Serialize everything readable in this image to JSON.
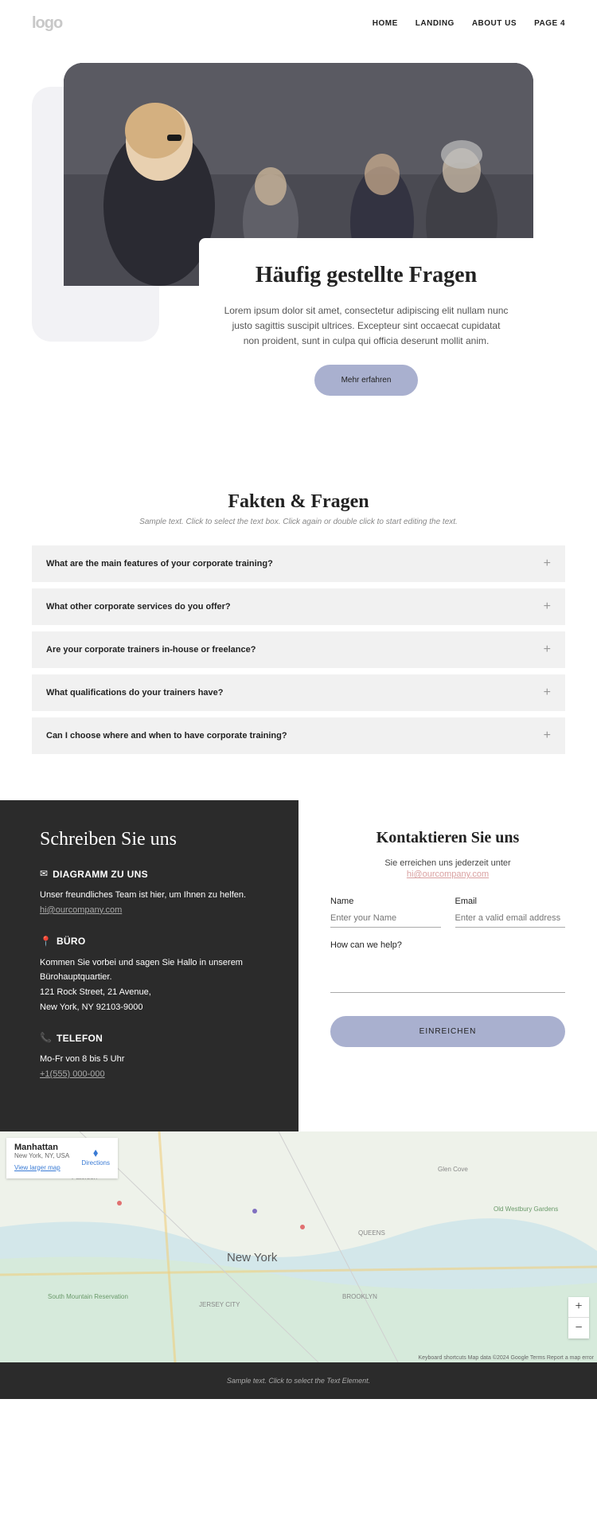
{
  "header": {
    "logo": "logo",
    "nav": [
      "HOME",
      "LANDING",
      "ABOUT US",
      "PAGE 4"
    ]
  },
  "hero": {
    "title": "Häufig gestellte Fragen",
    "text": "Lorem ipsum dolor sit amet, consectetur adipiscing elit nullam nunc justo sagittis suscipit ultrices. Excepteur sint occaecat cupidatat non proident, sunt in culpa qui officia deserunt mollit anim.",
    "button": "Mehr erfahren"
  },
  "faq": {
    "title": "Fakten & Fragen",
    "subtitle": "Sample text. Click to select the text box. Click again or double click to start editing the text.",
    "items": [
      "What are the main features of your corporate training?",
      "What other corporate services do you offer?",
      "Are your corporate trainers in-house or freelance?",
      "What qualifications do your trainers have?",
      "Can I choose where and when to have corporate training?"
    ]
  },
  "contact_left": {
    "title": "Schreiben Sie uns",
    "sections": [
      {
        "icon": "✉",
        "head": "DIAGRAMM ZU UNS",
        "body": "Unser freundliches Team ist hier, um Ihnen zu helfen.",
        "link": "hi@ourcompany.com"
      },
      {
        "icon": "📍",
        "head": "BÜRO",
        "body": "Kommen Sie vorbei und sagen Sie Hallo in unserem Bürohauptquartier.",
        "addr1": "121 Rock Street, 21 Avenue,",
        "addr2": "New York, NY 92103-9000"
      },
      {
        "icon": "📞",
        "head": "TELEFON",
        "body": "Mo-Fr von 8 bis 5 Uhr",
        "link": "+1(555) 000-000"
      }
    ]
  },
  "contact_right": {
    "title": "Kontaktieren Sie uns",
    "subtitle": "Sie erreichen uns jederzeit unter",
    "email": "hi@ourcompany.com",
    "name_label": "Name",
    "name_ph": "Enter your Name",
    "email_label": "Email",
    "email_ph": "Enter a valid email address",
    "help_label": "How can we help?",
    "submit": "EINREICHEN"
  },
  "map": {
    "box_title": "Manhattan",
    "box_sub": "New York, NY, USA",
    "box_link": "View larger map",
    "directions": "Directions",
    "city": "New York",
    "attribution": "Keyboard shortcuts   Map data ©2024 Google   Terms   Report a map error"
  },
  "footer": {
    "text": "Sample text. Click to select the Text Element."
  }
}
